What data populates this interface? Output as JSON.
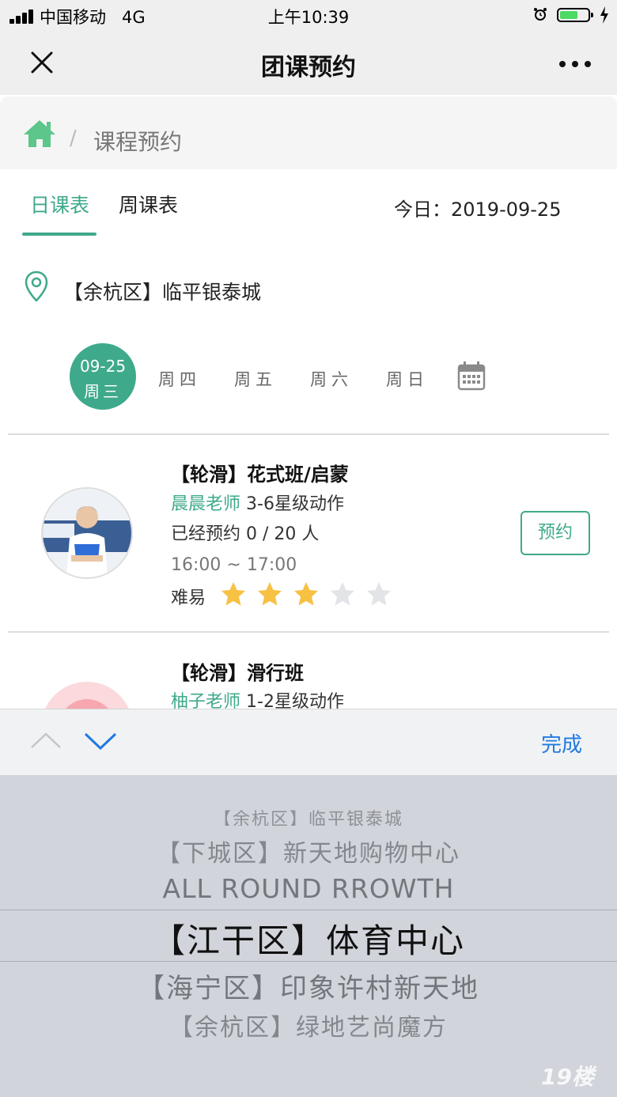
{
  "status_bar": {
    "carrier": "中国移动",
    "network": "4G",
    "time": "上午10:39"
  },
  "nav": {
    "title": "团课预约"
  },
  "breadcrumb": {
    "separator": "/",
    "label": "课程预约"
  },
  "tabs": [
    {
      "label": "日课表",
      "active": true
    },
    {
      "label": "周课表",
      "active": false
    }
  ],
  "today": "今日：2019-09-25",
  "location": "【余杭区】临平银泰城",
  "date_selector": {
    "active": {
      "date": "09-25",
      "weekday": "周三"
    },
    "days": [
      "周四",
      "周五",
      "周六",
      "周日"
    ]
  },
  "courses": [
    {
      "title": "【轮滑】花式班/启蒙",
      "teacher": "晨晨老师",
      "level": "3-6星级动作",
      "booked": "已经预约 0 / 20 人",
      "time": "16:00 ~ 17:00",
      "difficulty_label": "难易",
      "difficulty": 3,
      "difficulty_max": 5,
      "button": "预约"
    },
    {
      "title": "【轮滑】滑行班",
      "teacher": "柚子老师",
      "level": "1-2星级动作"
    }
  ],
  "picker": {
    "done_label": "完成",
    "options": [
      "【余杭区】临平银泰城",
      "【下城区】新天地购物中心",
      "ALL ROUND RROWTH",
      "【江干区】体育中心",
      "【海宁区】印象许村新天地",
      "【余杭区】绿地艺尚魔方"
    ],
    "selected_index": 3
  },
  "watermark": "19楼",
  "colors": {
    "accent": "#3fa98b",
    "star_on": "#f7c144",
    "star_off": "#e3e4e8",
    "link_blue": "#1f7ae0"
  }
}
